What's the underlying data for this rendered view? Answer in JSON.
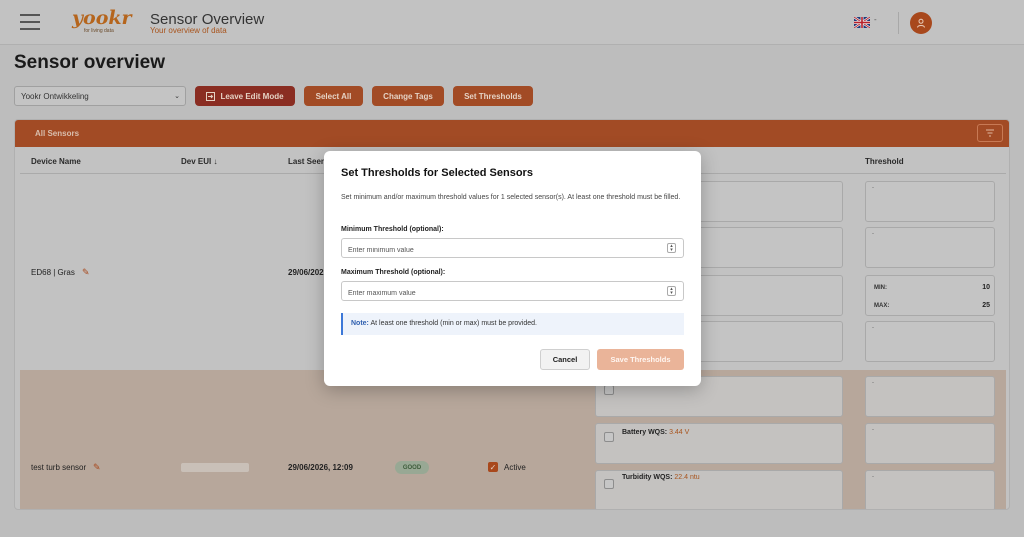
{
  "header": {
    "logo_text": "yookr",
    "logo_tagline": "for living data",
    "title": "Sensor Overview",
    "subtitle": "Your overview of data",
    "language_caret": "-"
  },
  "page": {
    "title": "Sensor overview",
    "site_select": "Yookr Ontwikkeling",
    "toolbar": {
      "leave_edit": "Leave Edit Mode",
      "select_all": "Select All",
      "change_tags": "Change Tags",
      "set_thresholds": "Set Thresholds"
    }
  },
  "table": {
    "tab_label": "All Sensors",
    "columns": {
      "device_name": "Device Name",
      "dev_eui": "Dev EUI ↓",
      "last_seen": "Last Seen",
      "threshold": "Threshold"
    },
    "rows": [
      {
        "name": "ED68 | Gras",
        "last_seen": "29/06/202",
        "thresholds": [
          {
            "text": "-"
          },
          {
            "text": "-"
          },
          {
            "min_label": "MIN:",
            "min": "10",
            "max_label": "MAX:",
            "max": "25"
          },
          {
            "text": "-"
          }
        ]
      },
      {
        "name": "test turb sensor",
        "last_seen": "29/06/2026, 12:09",
        "status": "GOOD",
        "active_label": "Active",
        "metrics": [
          {
            "label": "Battery WQS:",
            "value": "3.44 V"
          },
          {
            "label": "Turbidity WQS:",
            "value": "22.4 ntu"
          }
        ],
        "thresholds": [
          {
            "text": "-"
          },
          {
            "text": "-"
          },
          {
            "text": "-"
          }
        ]
      }
    ]
  },
  "modal": {
    "title": "Set Thresholds for Selected Sensors",
    "description": "Set minimum and/or maximum threshold values for 1 selected sensor(s). At least one threshold must be filled.",
    "min_label": "Minimum Threshold (optional):",
    "min_placeholder": "Enter minimum value",
    "max_label": "Maximum Threshold (optional):",
    "max_placeholder": "Enter maximum value",
    "note_label": "Note:",
    "note_text": "At least one threshold (min or max) must be provided.",
    "cancel": "Cancel",
    "save": "Save Thresholds"
  },
  "colors": {
    "brand": "#a8481c",
    "primary_button": "#eab499",
    "note_accent": "#3c78d8"
  }
}
